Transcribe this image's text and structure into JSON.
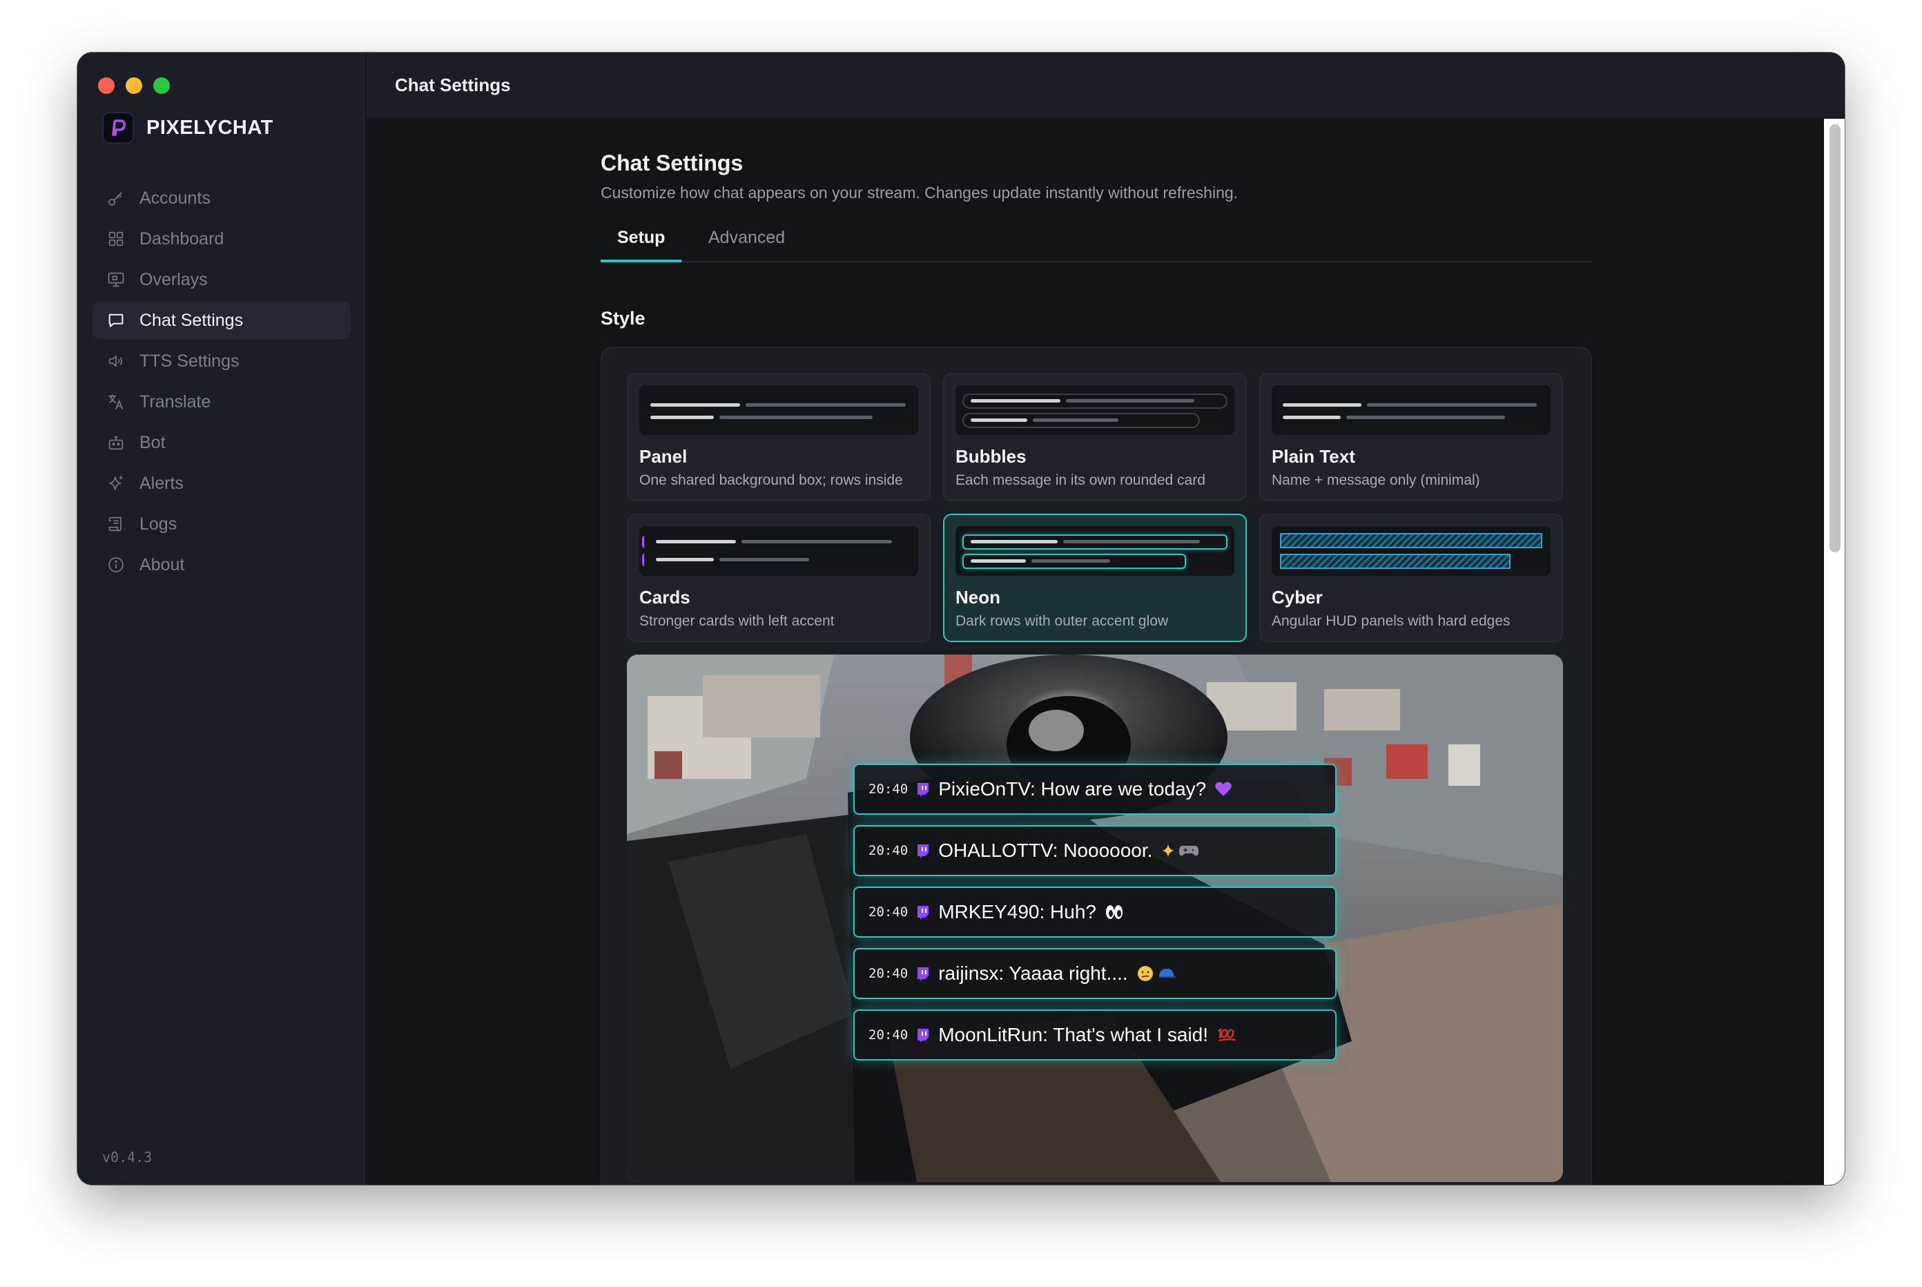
{
  "app": {
    "brand": "PIXELYCHAT",
    "version": "v0.4.3",
    "topbar_title": "Chat Settings"
  },
  "sidebar": {
    "items": [
      {
        "label": "Accounts",
        "icon": "key-icon"
      },
      {
        "label": "Dashboard",
        "icon": "grid-icon"
      },
      {
        "label": "Overlays",
        "icon": "monitor-icon"
      },
      {
        "label": "Chat Settings",
        "icon": "chat-bubble-icon",
        "active": true
      },
      {
        "label": "TTS Settings",
        "icon": "speaker-icon"
      },
      {
        "label": "Translate",
        "icon": "translate-icon"
      },
      {
        "label": "Bot",
        "icon": "robot-icon"
      },
      {
        "label": "Alerts",
        "icon": "sparkle-icon"
      },
      {
        "label": "Logs",
        "icon": "scroll-icon"
      },
      {
        "label": "About",
        "icon": "info-icon"
      }
    ]
  },
  "page": {
    "title": "Chat Settings",
    "subtitle": "Customize how chat appears on your stream. Changes update instantly without refreshing.",
    "tabs": [
      {
        "label": "Setup",
        "active": true
      },
      {
        "label": "Advanced",
        "active": false
      }
    ],
    "section_title": "Style"
  },
  "styles": [
    {
      "name": "Panel",
      "desc": "One shared background box; rows inside"
    },
    {
      "name": "Bubbles",
      "desc": "Each message in its own rounded card"
    },
    {
      "name": "Plain Text",
      "desc": "Name + message only (minimal)"
    },
    {
      "name": "Cards",
      "desc": "Stronger cards with left accent"
    },
    {
      "name": "Neon",
      "desc": "Dark rows with outer accent glow",
      "selected": true
    },
    {
      "name": "Cyber",
      "desc": "Angular HUD panels with hard edges"
    }
  ],
  "preview_messages": [
    {
      "time": "20:40",
      "text": "PixieOnTV: How are we today?",
      "emoji": "purple-heart"
    },
    {
      "time": "20:40",
      "text": "OHALLOTTV: Noooooor.",
      "emoji": "sparkles-gamepad"
    },
    {
      "time": "20:40",
      "text": "MRKEY490: Huh?",
      "emoji": "eyes"
    },
    {
      "time": "20:40",
      "text": "raijinsx: Yaaaa right....",
      "emoji": "smirk-cap"
    },
    {
      "time": "20:40",
      "text": "MoonLitRun: That's what I said!",
      "emoji": "hundred"
    }
  ],
  "colors": {
    "accent": "#2fc6c0",
    "brand_purple": "#a855f7",
    "twitch": "#9146ff"
  }
}
